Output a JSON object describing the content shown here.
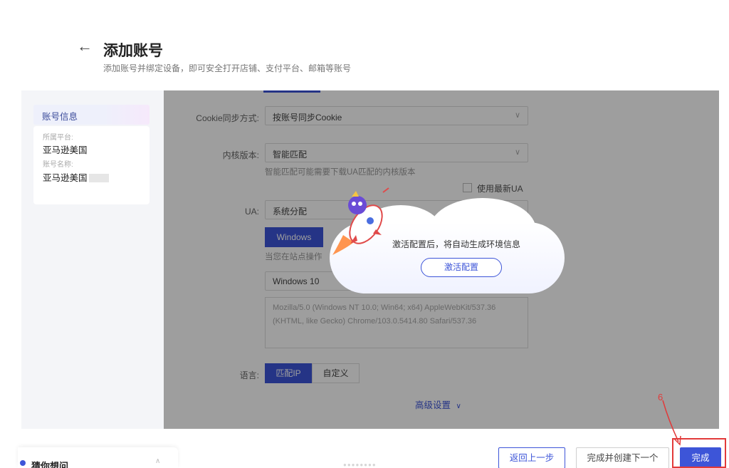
{
  "header": {
    "title": "添加账号",
    "subtitle": "添加账号并绑定设备，即可安全打开店铺、支付平台、邮箱等账号"
  },
  "sidebar": {
    "tab_label": "账号信息",
    "platform_label": "所属平台:",
    "platform_value": "亚马逊美国",
    "account_label": "账号名称:",
    "account_value": "亚马逊美国"
  },
  "form": {
    "cookie_label": "Cookie同步方式:",
    "cookie_value": "按账号同步Cookie",
    "kernel_label": "内核版本:",
    "kernel_value": "智能匹配",
    "kernel_hint": "智能匹配可能需要下载UA匹配的内核版本",
    "keep_ua_label": "使用最新UA",
    "ua_label": "UA:",
    "ua_value": "系统分配",
    "os_button": "Windows",
    "os_hint": "当您在站点操作",
    "os_version": "Windows 10",
    "ua_string": "Mozilla/5.0 (Windows NT 10.0; Win64; x64) AppleWebKit/537.36 (KHTML, like Gecko) Chrome/103.0.5414.80 Safari/537.36",
    "language_label": "语言:",
    "language_ip": "匹配IP",
    "language_custom": "自定义",
    "advanced_label": "高级设置",
    "advanced_icon": "chevron-down-icon"
  },
  "popup": {
    "message": "激活配置后，将自动生成环境信息",
    "button": "激活配置"
  },
  "footer": {
    "assistant_label": "猜你想问",
    "prev_button": "返回上一步",
    "next_button": "完成并创建下一个",
    "done_button": "完成"
  },
  "annotation": {
    "step_number": "6"
  },
  "colors": {
    "accent": "#3d55d8",
    "annotation": "#e23a3a"
  }
}
